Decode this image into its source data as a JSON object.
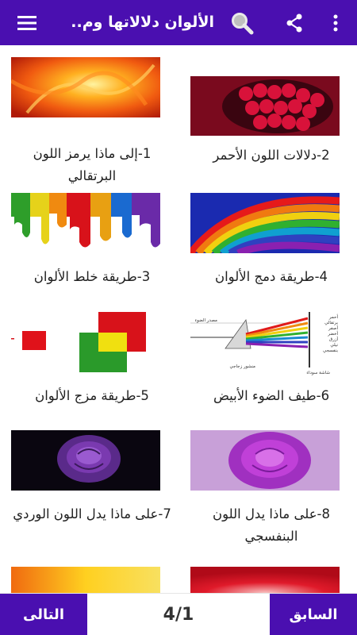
{
  "app_bar": {
    "title": "الألوان دلالاتها وم...",
    "menu_icon": "hamburger-menu-icon",
    "search_icon": "search-icon",
    "share_icon": "share-icon",
    "more_icon": "more-vert-icon",
    "color": "#4a0fb0"
  },
  "articles": [
    {
      "caption": "1-إلى ماذا يرمز اللون البرتقالي",
      "image": "orange-fire-image"
    },
    {
      "caption": "2-دلالات اللون الأحمر",
      "image": "raspberries-image"
    },
    {
      "caption": "3-طريقة خلط الألوان",
      "image": "paint-drips-image"
    },
    {
      "caption": "4-طريقة دمج الألوان",
      "image": "rainbow-swirl-image"
    },
    {
      "caption": "5-طريقة مزج الألوان",
      "image": "color-squares-image"
    },
    {
      "caption": "6-طيف الضوء الأبيض",
      "image": "prism-spectrum-image"
    },
    {
      "caption": "7-على ماذا يدل اللون الوردي",
      "image": "purple-rose-dark-image"
    },
    {
      "caption": "8-على ماذا يدل اللون البنفسجي",
      "image": "purple-rose-light-image"
    },
    {
      "caption": "",
      "image": "yellow-swirl-image"
    },
    {
      "caption": "",
      "image": "red-swirl-image"
    }
  ],
  "prism_diagram": {
    "light_source": "مصدر الضوء",
    "prism": "منشور زجاجي",
    "screen": "شاشة سوداء",
    "colors": [
      "أحمر",
      "برتقالي",
      "أصفر",
      "أخضر",
      "أزرق",
      "نيلي",
      "بنفسجي"
    ]
  },
  "pagination": {
    "next_label": "التالى",
    "prev_label": "السابق",
    "indicator": "4/1"
  }
}
